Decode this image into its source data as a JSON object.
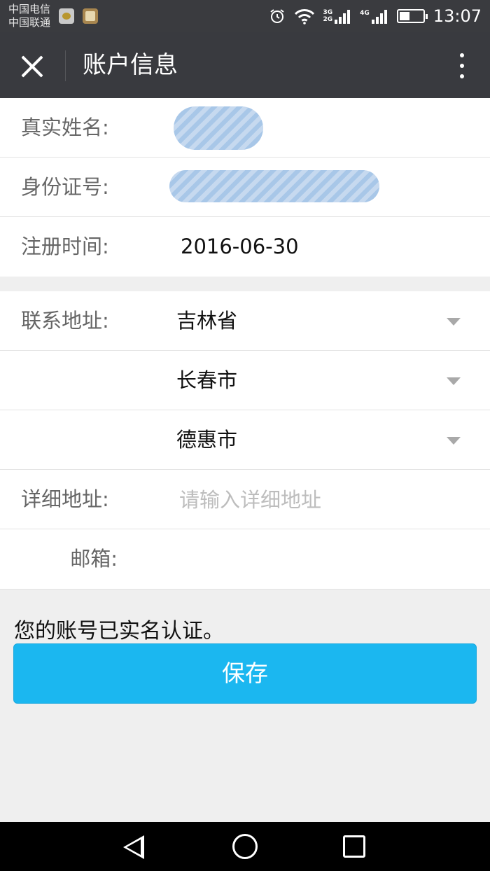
{
  "status_bar": {
    "carrier_1": "中国电信",
    "carrier_2": "中国联通",
    "net_1_top": "3G",
    "net_1_bottom": "2G",
    "net_2": "4G",
    "time": "13:07",
    "battery_level": 0.45
  },
  "header": {
    "title": "账户信息"
  },
  "section_personal": {
    "name_label": "真实姓名:",
    "id_label": "身份证号:",
    "reg_label": "注册时间:",
    "reg_value": "2016-06-30"
  },
  "section_address": {
    "contact_label": "联系地址:",
    "province": "吉林省",
    "city": "长春市",
    "district": "德惠市",
    "detail_label": "详细地址:",
    "detail_placeholder": "请输入详细地址",
    "email_label": "邮箱:"
  },
  "verify_text": "您的账号已实名认证。",
  "save_label": "保存",
  "colors": {
    "header_bg": "#393a3f",
    "accent": "#1bb7f0",
    "page_bg": "#efefef"
  }
}
